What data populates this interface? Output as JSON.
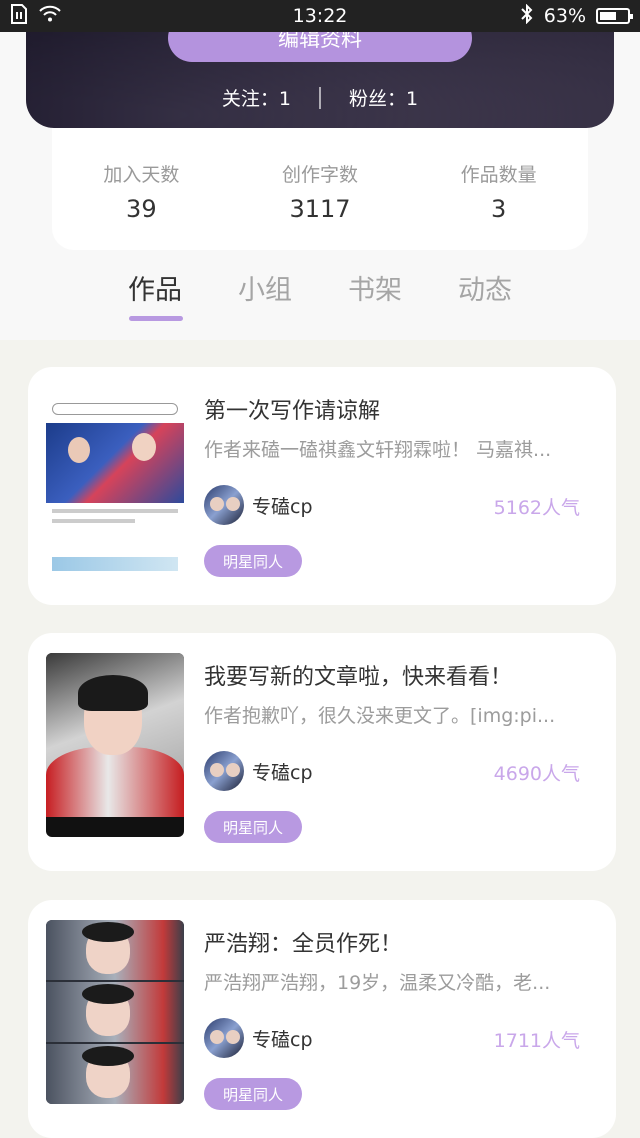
{
  "status_bar": {
    "time": "13:22",
    "battery": "63%",
    "battery_level": 0.63
  },
  "profile": {
    "edit_button": "编辑资料",
    "following": "关注：1",
    "followers": "粉丝：1"
  },
  "stats": [
    {
      "label": "加入天数",
      "value": "39"
    },
    {
      "label": "创作字数",
      "value": "3117"
    },
    {
      "label": "作品数量",
      "value": "3"
    }
  ],
  "tabs": [
    {
      "label": "作品",
      "active": true
    },
    {
      "label": "小组",
      "active": false
    },
    {
      "label": "书架",
      "active": false
    },
    {
      "label": "动态",
      "active": false
    }
  ],
  "works": [
    {
      "title": "第一次写作请谅解",
      "desc": "作者来磕一磕祺鑫文轩翔霖啦！ 马嘉祺...",
      "author": "专磕cp",
      "popularity": "5162人气",
      "tag": "明星同人"
    },
    {
      "title": "我要写新的文章啦，快来看看！",
      "desc": "作者抱歉吖，很久没来更文了。[img:pi...",
      "author": "专磕cp",
      "popularity": "4690人气",
      "tag": "明星同人"
    },
    {
      "title": "严浩翔：全员作死！",
      "desc": "严浩翔严浩翔，19岁，温柔又冷酷，老...",
      "author": "专磕cp",
      "popularity": "1711人气",
      "tag": "明星同人"
    }
  ],
  "colors": {
    "accent": "#b899e1",
    "popularity": "#c9a7ea"
  }
}
